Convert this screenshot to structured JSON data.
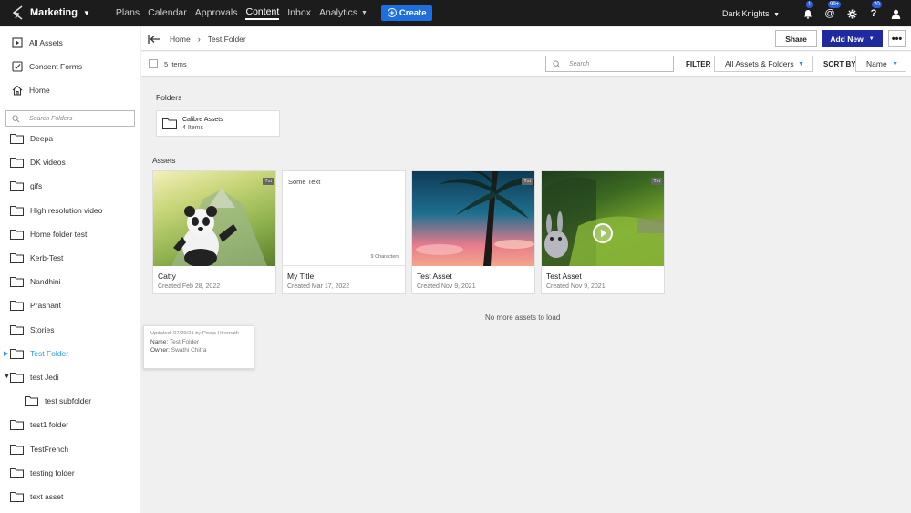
{
  "topbar": {
    "brand": "Marketing",
    "nav": [
      "Plans",
      "Calendar",
      "Approvals",
      "Content",
      "Inbox",
      "Analytics"
    ],
    "create_label": "Create",
    "team": "Dark Knights",
    "notification_count": "1",
    "mention_count": "99+",
    "help_count": "20"
  },
  "sidebar": {
    "links": [
      "All Assets",
      "Consent Forms",
      "Home"
    ],
    "search_placeholder": "Search Folders",
    "folders": [
      "Deepa",
      "DK videos",
      "gifs",
      "High resolution video",
      "Home folder test",
      "Kerb-Test",
      "Nandhini",
      "Prashant",
      "Stories",
      "Test Folder",
      "test Jedi",
      "test subfolder",
      "test1 folder",
      "TestFrench",
      "testing folder",
      "text asset"
    ]
  },
  "header": {
    "breadcrumb_home": "Home",
    "breadcrumb_current": "Test Folder",
    "share_label": "Share",
    "add_new_label": "Add New"
  },
  "toolbar": {
    "count": "5 Items",
    "search_placeholder": "Search",
    "filter_label": "FILTER",
    "filter_value": "All Assets & Folders",
    "sort_label": "SORT BY",
    "sort_value": "Name"
  },
  "main": {
    "folders_title": "Folders",
    "folder": {
      "name": "Calibre Assets",
      "count": "4 Items"
    },
    "assets_title": "Assets",
    "assets": [
      {
        "title": "Catty",
        "date": "Created Feb 28, 2022",
        "tag": "Txt"
      },
      {
        "title": "My Title",
        "date": "Created Mar 17, 2022",
        "preview": "Some Text",
        "chars": "9 Characters"
      },
      {
        "title": "Test Asset",
        "date": "Created Nov 9, 2021",
        "tag": "Txt"
      },
      {
        "title": "Test Asset",
        "date": "Created Nov 9, 2021",
        "tag": "Txt"
      }
    ],
    "no_more": "No more assets to load",
    "tooltip": {
      "updated": "Updated: 07/29/21 by Pooja Hiremath",
      "name_label": "Name:",
      "name": "Test Folder",
      "owner_label": "Owner:",
      "owner": "Swathi Chitra"
    }
  },
  "colors": {
    "accent": "#2a9bd6",
    "primary_button": "#1f2a9e",
    "create_button": "#1d6fe0",
    "topbar": "#1c1c1c"
  }
}
